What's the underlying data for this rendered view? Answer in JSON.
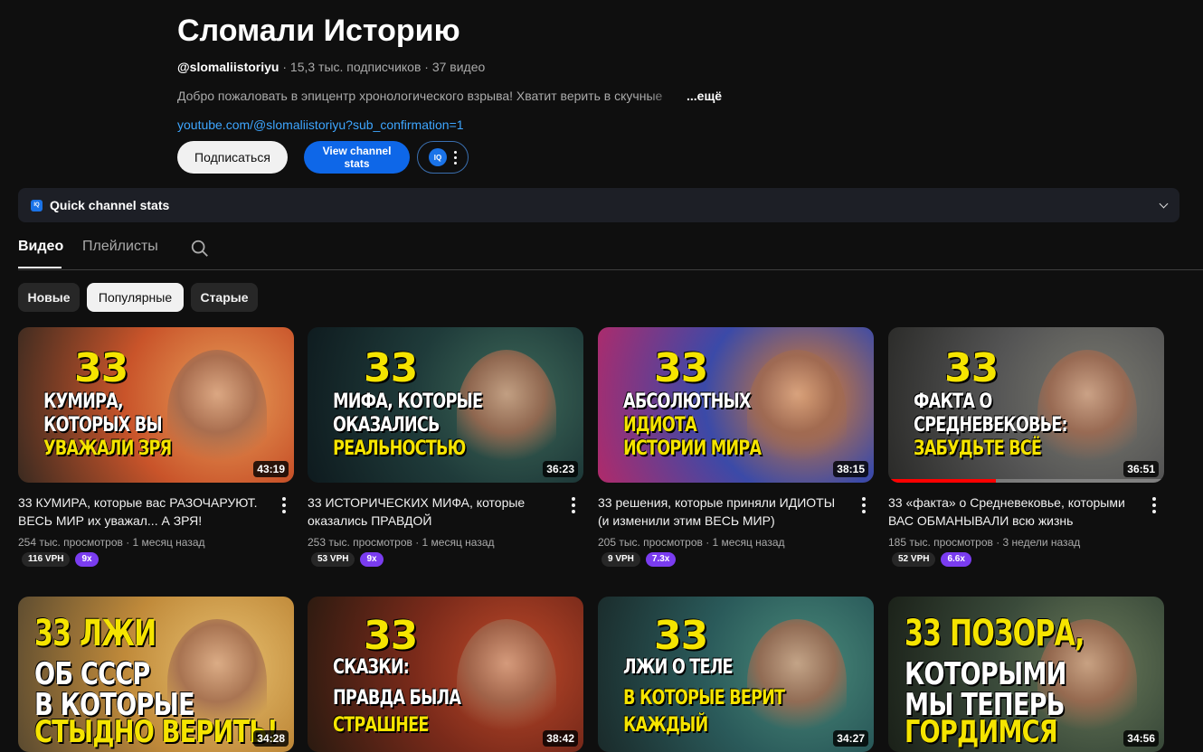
{
  "channel": {
    "name": "Сломали Историю",
    "handle": "@slomaliistoriyu",
    "stats": " · 15,3 тыс. подписчиков · 37 видео",
    "description": "Добро пожаловать в эпицентр хронологического взрыва! Хватит верить в скучные",
    "more_label": "...ещё",
    "link": "youtube.com/@slomaliistoriyu?sub_confirmation=1"
  },
  "buttons": {
    "subscribe": "Подписаться",
    "view_stats": "View channel stats",
    "iq_badge": "IQ"
  },
  "quick_stats": {
    "label": "Quick channel stats",
    "icon": "IQ"
  },
  "tabs": {
    "videos": "Видео",
    "playlists": "Плейлисты"
  },
  "chips": [
    "Новые",
    "Популярные",
    "Старые"
  ],
  "videos": [
    {
      "title": "33 КУМИРА, которые вас РАЗОЧАРУЮТ. ВЕСЬ МИР их уважал... А ЗРЯ!",
      "meta": "254 тыс. просмотров · 1 месяц назад",
      "duration": "43:19",
      "vph": "116 VPH",
      "multiplier": "9x",
      "thumb": {
        "num": "33",
        "lines": [
          "КУМИРА,",
          "КОТОРЫХ ВЫ",
          "УВАЖАЛИ ЗРЯ"
        ],
        "colors": [
          "#c9542a",
          "#e8a05a",
          "#3a2a20"
        ]
      }
    },
    {
      "title": "33 ИСТОРИЧЕСКИХ МИФА, которые оказались ПРАВДОЙ",
      "meta": "253 тыс. просмотров · 1 месяц назад",
      "duration": "36:23",
      "vph": "53 VPH",
      "multiplier": "9x",
      "thumb": {
        "num": "33",
        "lines": [
          "МИФА, КОТОРЫЕ",
          "ОКАЗАЛИСЬ",
          "РЕАЛЬНОСТЬЮ"
        ],
        "colors": [
          "#1f3b3a",
          "#3f6a5a",
          "#0e1a1e"
        ]
      }
    },
    {
      "title": "33 решения, которые приняли ИДИОТЫ (и изменили этим ВЕСЬ МИР)",
      "meta": "205 тыс. просмотров · 1 месяц назад",
      "duration": "38:15",
      "vph": "9 VPH",
      "multiplier": "7.3x",
      "thumb": {
        "num": "33",
        "lines": [
          "АБСОЛЮТНЫХ",
          "ИДИОТА",
          "ИСТОРИИ МИРА"
        ],
        "colors": [
          "#3b4aa8",
          "#e0802a",
          "#b02a6a"
        ]
      }
    },
    {
      "title": "33 «факта» о Средневековье, которыми ВАС ОБМАНЫВАЛИ всю жизнь",
      "meta": "185 тыс. просмотров · 3 недели назад",
      "duration": "36:51",
      "vph": "52 VPH",
      "multiplier": "6.6x",
      "watched_fraction": 0.39,
      "thumb": {
        "num": "33",
        "lines": [
          "ФАКТА О",
          "СРЕДНЕВЕКОВЬЕ:",
          "ЗАБУДЬТЕ ВСЁ"
        ],
        "colors": [
          "#555",
          "#7a7a70",
          "#2a2a28"
        ]
      }
    },
    {
      "title": "",
      "meta": "",
      "duration": "34:28",
      "thumb": {
        "num": "33 ЛЖИ",
        "lines": [
          "ОБ СССР",
          "В КОТОРЫЕ",
          "СТЫДНО ВЕРИТЬ!"
        ],
        "colors": [
          "#c08a3a",
          "#e8c070",
          "#5a4a30"
        ]
      }
    },
    {
      "title": "",
      "meta": "",
      "duration": "38:42",
      "thumb": {
        "num": "33",
        "lines": [
          "СКАЗКИ:",
          "ПРАВДА БЫЛА",
          "СТРАШНЕЕ"
        ],
        "colors": [
          "#7a2a1a",
          "#c04a2a",
          "#2a1a10"
        ]
      }
    },
    {
      "title": "",
      "meta": "",
      "duration": "34:27",
      "thumb": {
        "num": "33",
        "lines": [
          "ЛЖИ О ТЕЛЕ",
          "В КОТОРЫЕ ВЕРИТ",
          "КАЖДЫЙ"
        ],
        "colors": [
          "#2a5a5a",
          "#4a8a7a",
          "#1a2a2a"
        ]
      }
    },
    {
      "title": "",
      "meta": "",
      "duration": "34:56",
      "thumb": {
        "num": "33 ПОЗОРА,",
        "lines": [
          "КОТОРЫМИ",
          "МЫ ТЕПЕРЬ",
          "ГОРДИМСЯ"
        ],
        "colors": [
          "#3a4a3a",
          "#6a7a5a",
          "#1a2018"
        ]
      }
    }
  ]
}
